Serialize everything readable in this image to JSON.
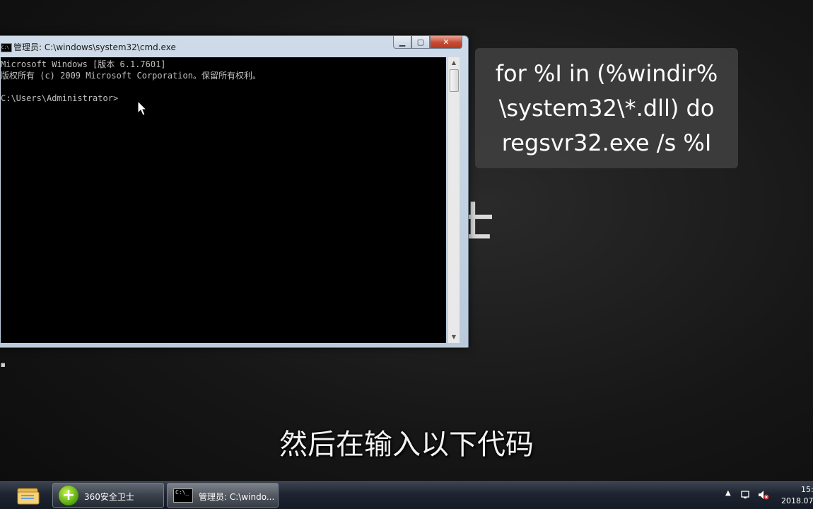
{
  "window": {
    "title": "管理员: C:\\windows\\system32\\cmd.exe",
    "minimize_glyph": "▁",
    "maximize_glyph": "▢",
    "close_glyph": "✕",
    "console_lines": [
      "Microsoft Windows [版本 6.1.7601]",
      "版权所有 (c) 2009 Microsoft Corporation。保留所有权利。",
      "",
      "C:\\Users\\Administrator>"
    ]
  },
  "background": {
    "logo_fragment": "士"
  },
  "code_overlay": {
    "lines": [
      "for %I in (%windir%",
      "\\system32\\*.dll) do",
      "regsvr32.exe /s %I"
    ]
  },
  "subtitle": "然后在输入以下代码",
  "taskbar": {
    "tasks": [
      {
        "label": "360安全卫士",
        "icon": "360-shield-icon"
      },
      {
        "label": "管理员: C:\\windo...",
        "icon": "cmd-icon"
      }
    ],
    "clock_time": "15:",
    "clock_date": "2018.07"
  },
  "colors": {
    "console_bg": "#000000",
    "console_text": "#c0c0c0",
    "close_button": "#c44a32"
  }
}
